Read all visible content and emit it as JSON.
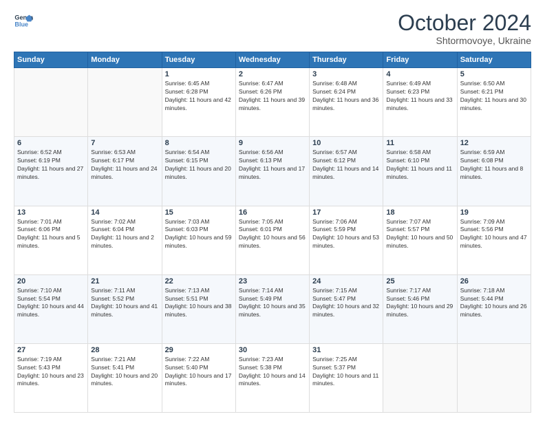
{
  "header": {
    "logo_line1": "General",
    "logo_line2": "Blue",
    "month": "October 2024",
    "location": "Shtormovoye, Ukraine"
  },
  "weekdays": [
    "Sunday",
    "Monday",
    "Tuesday",
    "Wednesday",
    "Thursday",
    "Friday",
    "Saturday"
  ],
  "weeks": [
    [
      {
        "day": "",
        "sunrise": "",
        "sunset": "",
        "daylight": ""
      },
      {
        "day": "",
        "sunrise": "",
        "sunset": "",
        "daylight": ""
      },
      {
        "day": "1",
        "sunrise": "Sunrise: 6:45 AM",
        "sunset": "Sunset: 6:28 PM",
        "daylight": "Daylight: 11 hours and 42 minutes."
      },
      {
        "day": "2",
        "sunrise": "Sunrise: 6:47 AM",
        "sunset": "Sunset: 6:26 PM",
        "daylight": "Daylight: 11 hours and 39 minutes."
      },
      {
        "day": "3",
        "sunrise": "Sunrise: 6:48 AM",
        "sunset": "Sunset: 6:24 PM",
        "daylight": "Daylight: 11 hours and 36 minutes."
      },
      {
        "day": "4",
        "sunrise": "Sunrise: 6:49 AM",
        "sunset": "Sunset: 6:23 PM",
        "daylight": "Daylight: 11 hours and 33 minutes."
      },
      {
        "day": "5",
        "sunrise": "Sunrise: 6:50 AM",
        "sunset": "Sunset: 6:21 PM",
        "daylight": "Daylight: 11 hours and 30 minutes."
      }
    ],
    [
      {
        "day": "6",
        "sunrise": "Sunrise: 6:52 AM",
        "sunset": "Sunset: 6:19 PM",
        "daylight": "Daylight: 11 hours and 27 minutes."
      },
      {
        "day": "7",
        "sunrise": "Sunrise: 6:53 AM",
        "sunset": "Sunset: 6:17 PM",
        "daylight": "Daylight: 11 hours and 24 minutes."
      },
      {
        "day": "8",
        "sunrise": "Sunrise: 6:54 AM",
        "sunset": "Sunset: 6:15 PM",
        "daylight": "Daylight: 11 hours and 20 minutes."
      },
      {
        "day": "9",
        "sunrise": "Sunrise: 6:56 AM",
        "sunset": "Sunset: 6:13 PM",
        "daylight": "Daylight: 11 hours and 17 minutes."
      },
      {
        "day": "10",
        "sunrise": "Sunrise: 6:57 AM",
        "sunset": "Sunset: 6:12 PM",
        "daylight": "Daylight: 11 hours and 14 minutes."
      },
      {
        "day": "11",
        "sunrise": "Sunrise: 6:58 AM",
        "sunset": "Sunset: 6:10 PM",
        "daylight": "Daylight: 11 hours and 11 minutes."
      },
      {
        "day": "12",
        "sunrise": "Sunrise: 6:59 AM",
        "sunset": "Sunset: 6:08 PM",
        "daylight": "Daylight: 11 hours and 8 minutes."
      }
    ],
    [
      {
        "day": "13",
        "sunrise": "Sunrise: 7:01 AM",
        "sunset": "Sunset: 6:06 PM",
        "daylight": "Daylight: 11 hours and 5 minutes."
      },
      {
        "day": "14",
        "sunrise": "Sunrise: 7:02 AM",
        "sunset": "Sunset: 6:04 PM",
        "daylight": "Daylight: 11 hours and 2 minutes."
      },
      {
        "day": "15",
        "sunrise": "Sunrise: 7:03 AM",
        "sunset": "Sunset: 6:03 PM",
        "daylight": "Daylight: 10 hours and 59 minutes."
      },
      {
        "day": "16",
        "sunrise": "Sunrise: 7:05 AM",
        "sunset": "Sunset: 6:01 PM",
        "daylight": "Daylight: 10 hours and 56 minutes."
      },
      {
        "day": "17",
        "sunrise": "Sunrise: 7:06 AM",
        "sunset": "Sunset: 5:59 PM",
        "daylight": "Daylight: 10 hours and 53 minutes."
      },
      {
        "day": "18",
        "sunrise": "Sunrise: 7:07 AM",
        "sunset": "Sunset: 5:57 PM",
        "daylight": "Daylight: 10 hours and 50 minutes."
      },
      {
        "day": "19",
        "sunrise": "Sunrise: 7:09 AM",
        "sunset": "Sunset: 5:56 PM",
        "daylight": "Daylight: 10 hours and 47 minutes."
      }
    ],
    [
      {
        "day": "20",
        "sunrise": "Sunrise: 7:10 AM",
        "sunset": "Sunset: 5:54 PM",
        "daylight": "Daylight: 10 hours and 44 minutes."
      },
      {
        "day": "21",
        "sunrise": "Sunrise: 7:11 AM",
        "sunset": "Sunset: 5:52 PM",
        "daylight": "Daylight: 10 hours and 41 minutes."
      },
      {
        "day": "22",
        "sunrise": "Sunrise: 7:13 AM",
        "sunset": "Sunset: 5:51 PM",
        "daylight": "Daylight: 10 hours and 38 minutes."
      },
      {
        "day": "23",
        "sunrise": "Sunrise: 7:14 AM",
        "sunset": "Sunset: 5:49 PM",
        "daylight": "Daylight: 10 hours and 35 minutes."
      },
      {
        "day": "24",
        "sunrise": "Sunrise: 7:15 AM",
        "sunset": "Sunset: 5:47 PM",
        "daylight": "Daylight: 10 hours and 32 minutes."
      },
      {
        "day": "25",
        "sunrise": "Sunrise: 7:17 AM",
        "sunset": "Sunset: 5:46 PM",
        "daylight": "Daylight: 10 hours and 29 minutes."
      },
      {
        "day": "26",
        "sunrise": "Sunrise: 7:18 AM",
        "sunset": "Sunset: 5:44 PM",
        "daylight": "Daylight: 10 hours and 26 minutes."
      }
    ],
    [
      {
        "day": "27",
        "sunrise": "Sunrise: 7:19 AM",
        "sunset": "Sunset: 5:43 PM",
        "daylight": "Daylight: 10 hours and 23 minutes."
      },
      {
        "day": "28",
        "sunrise": "Sunrise: 7:21 AM",
        "sunset": "Sunset: 5:41 PM",
        "daylight": "Daylight: 10 hours and 20 minutes."
      },
      {
        "day": "29",
        "sunrise": "Sunrise: 7:22 AM",
        "sunset": "Sunset: 5:40 PM",
        "daylight": "Daylight: 10 hours and 17 minutes."
      },
      {
        "day": "30",
        "sunrise": "Sunrise: 7:23 AM",
        "sunset": "Sunset: 5:38 PM",
        "daylight": "Daylight: 10 hours and 14 minutes."
      },
      {
        "day": "31",
        "sunrise": "Sunrise: 7:25 AM",
        "sunset": "Sunset: 5:37 PM",
        "daylight": "Daylight: 10 hours and 11 minutes."
      },
      {
        "day": "",
        "sunrise": "",
        "sunset": "",
        "daylight": ""
      },
      {
        "day": "",
        "sunrise": "",
        "sunset": "",
        "daylight": ""
      }
    ]
  ]
}
